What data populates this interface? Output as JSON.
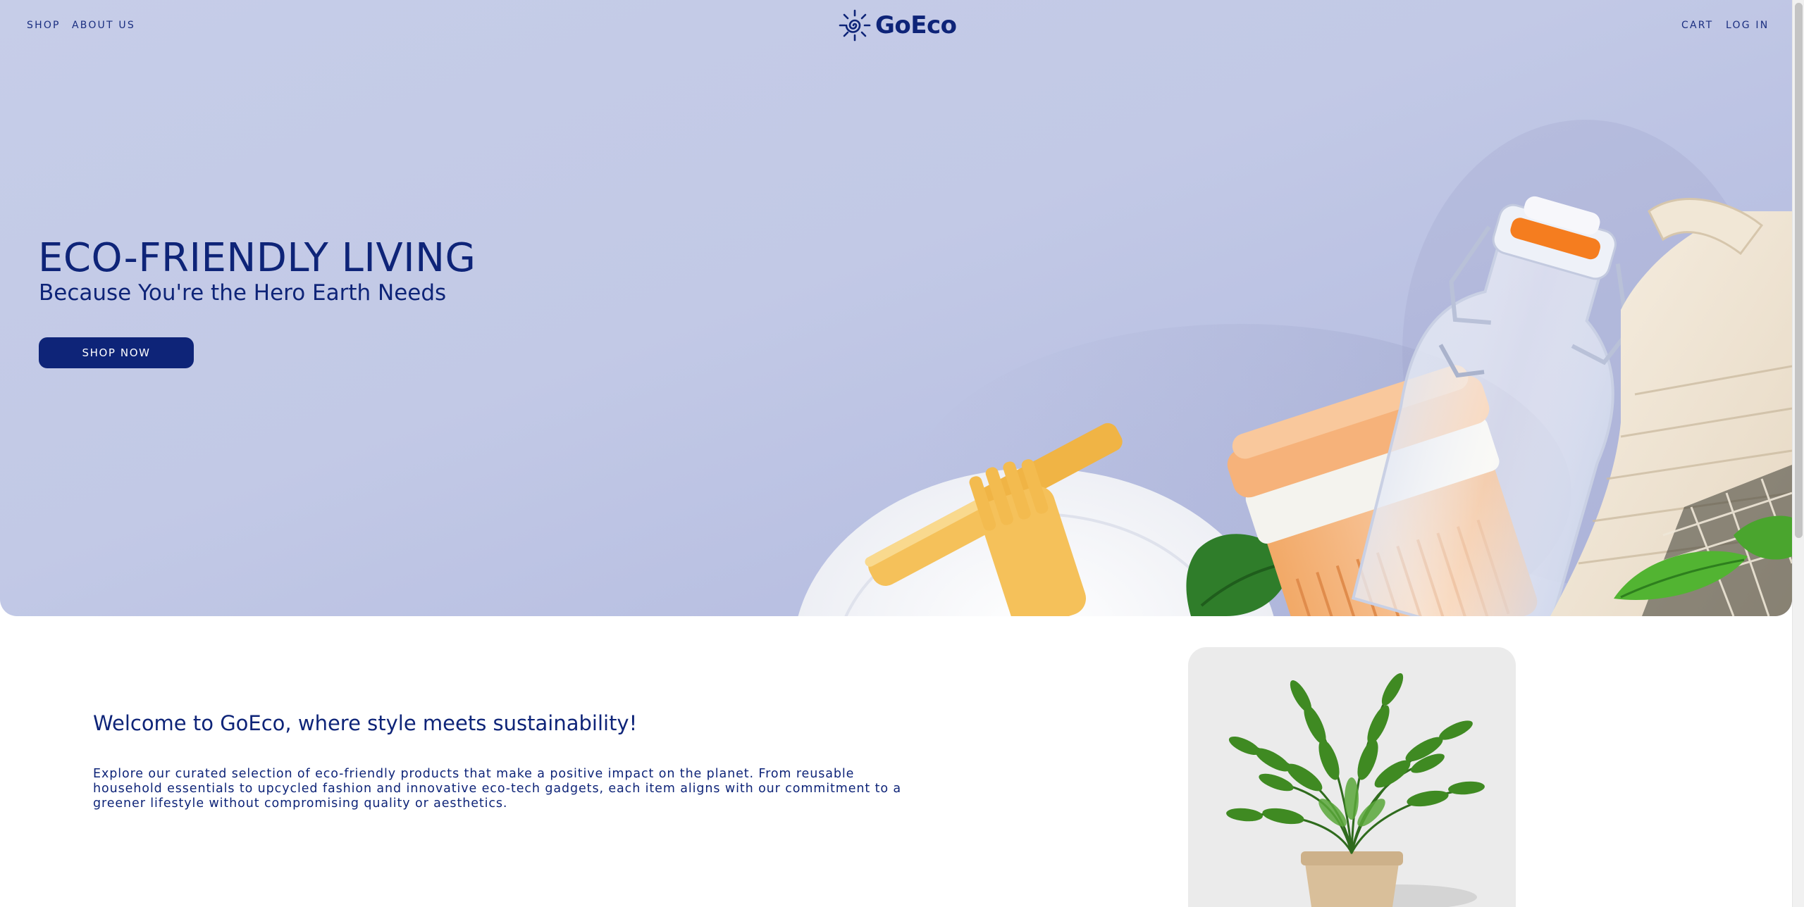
{
  "nav": {
    "left_links": [
      "SHOP",
      "ABOUT US"
    ],
    "right_links": [
      "CART",
      "LOG IN"
    ],
    "logo_text": "GoEco",
    "logo_icon": "sun-spiral-icon"
  },
  "hero": {
    "title": "ECO-FRIENDLY LIVING",
    "subtitle": "Because You're the Hero Earth Needs",
    "cta_label": "SHOP NOW"
  },
  "welcome": {
    "heading": "Welcome to GoEco, where style meets sustainability!",
    "body": "Explore our curated selection of eco-friendly products that make a positive impact on the planet. From reusable household essentials to upcycled fashion and innovative eco-tech gadgets, each item aligns with our commitment to a greener lifestyle without compromising quality or aesthetics."
  },
  "colors": {
    "brand_navy": "#0e2478",
    "hero_background": "#c2c9e6",
    "card_background": "#ebebeb"
  }
}
